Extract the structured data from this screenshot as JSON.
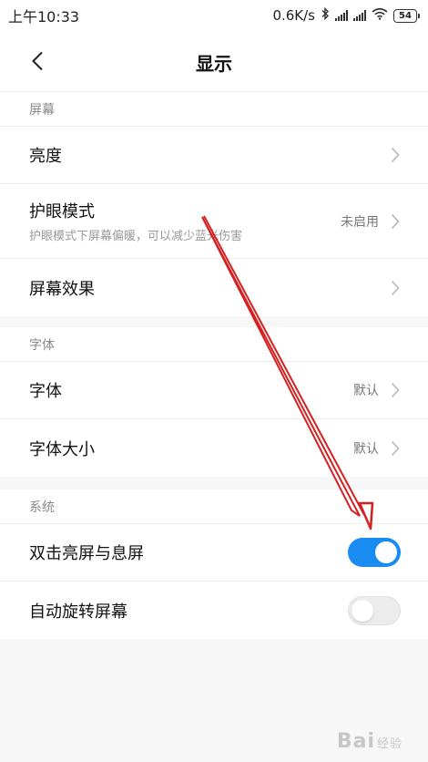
{
  "status_bar": {
    "time": "上午10:33",
    "network_speed": "0.6K/s",
    "battery": "54",
    "icons": [
      "bluetooth-icon",
      "signal-icon",
      "signal-icon",
      "wifi-icon",
      "battery-icon"
    ]
  },
  "header": {
    "title": "显示",
    "back_icon": "chevron-left-icon"
  },
  "sections": {
    "screen": {
      "title": "屏幕",
      "items": [
        {
          "label": "亮度",
          "value": ""
        },
        {
          "label": "护眼模式",
          "subtitle": "护眼模式下屏幕偏暖，可以减少蓝光伤害",
          "value": "未启用"
        },
        {
          "label": "屏幕效果",
          "value": ""
        }
      ]
    },
    "font": {
      "title": "字体",
      "items": [
        {
          "label": "字体",
          "value": "默认"
        },
        {
          "label": "字体大小",
          "value": "默认"
        }
      ]
    },
    "system": {
      "title": "系统",
      "items": [
        {
          "label": "双击亮屏与息屏",
          "toggle": true
        },
        {
          "label": "自动旋转屏幕",
          "toggle": false
        }
      ]
    }
  },
  "colors": {
    "accent": "#1a8cf1",
    "annotation_arrow": "#d42020"
  },
  "watermark": {
    "brand": "Bai",
    "sub": "经验"
  }
}
